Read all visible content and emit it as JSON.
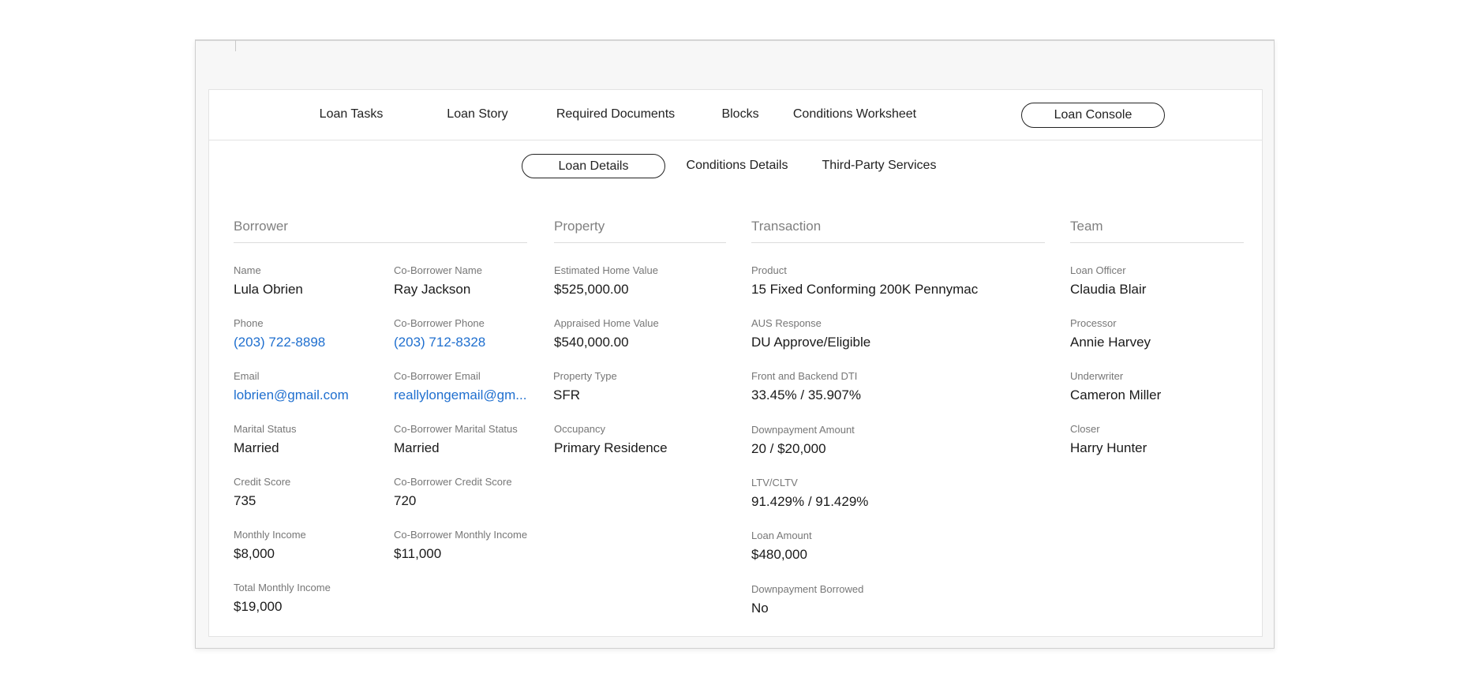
{
  "tabs": [
    {
      "label": "Loan Tasks"
    },
    {
      "label": "Loan Story"
    },
    {
      "label": "Required Documents"
    },
    {
      "label": "Blocks"
    },
    {
      "label": "Conditions Worksheet"
    },
    {
      "label": "Loan Console",
      "active": true
    }
  ],
  "subtabs": [
    {
      "label": "Loan Details",
      "active": true
    },
    {
      "label": "Conditions Details"
    },
    {
      "label": "Third-Party Services"
    }
  ],
  "borrower": {
    "title": "Borrower",
    "name": {
      "label": "Name",
      "value": "Lula Obrien"
    },
    "phone": {
      "label": "Phone",
      "value": "(203) 722-8898"
    },
    "email": {
      "label": "Email",
      "value": "lobrien@gmail.com"
    },
    "marital": {
      "label": "Marital Status",
      "value": "Married"
    },
    "credit": {
      "label": "Credit Score",
      "value": "735"
    },
    "income": {
      "label": "Monthly Income",
      "value": "$8,000"
    },
    "total_income": {
      "label": "Total Monthly Income",
      "value": "$19,000"
    },
    "co_name": {
      "label": "Co-Borrower Name",
      "value": "Ray Jackson"
    },
    "co_phone": {
      "label": "Co-Borrower Phone",
      "value": "(203) 712-8328"
    },
    "co_email": {
      "label": "Co-Borrower Email",
      "value": "reallylongemail@gm..."
    },
    "co_marital": {
      "label": "Co-Borrower Marital Status",
      "value": "Married"
    },
    "co_credit": {
      "label": "Co-Borrower Credit Score",
      "value": "720"
    },
    "co_income": {
      "label": "Co-Borrower Monthly Income",
      "value": "$11,000"
    }
  },
  "property": {
    "title": "Property",
    "est_value": {
      "label": "Estimated Home Value",
      "value": "$525,000.00"
    },
    "appraised": {
      "label": "Appraised Home Value",
      "value": "$540,000.00"
    },
    "type": {
      "label": "Property Type",
      "value": "SFR"
    },
    "occupancy": {
      "label": "Occupancy",
      "value": "Primary Residence"
    }
  },
  "transaction": {
    "title": "Transaction",
    "product": {
      "label": "Product",
      "value": "15 Fixed Conforming 200K Pennymac"
    },
    "aus": {
      "label": "AUS Response",
      "value": "DU Approve/Eligible"
    },
    "dti": {
      "label": "Front and Backend DTI",
      "value": "33.45% / 35.907%"
    },
    "downpayment": {
      "label": "Downpayment Amount",
      "value": "20 / $20,000"
    },
    "ltv": {
      "label": "LTV/CLTV",
      "value": "91.429% / 91.429%"
    },
    "loan_amount": {
      "label": "Loan Amount",
      "value": "$480,000"
    },
    "dp_borrowed": {
      "label": "Downpayment Borrowed",
      "value": "No"
    }
  },
  "team": {
    "title": "Team",
    "loan_officer": {
      "label": "Loan Officer",
      "value": "Claudia Blair"
    },
    "processor": {
      "label": "Processor",
      "value": "Annie Harvey"
    },
    "underwriter": {
      "label": "Underwriter",
      "value": "Cameron Miller"
    },
    "closer": {
      "label": "Closer",
      "value": "Harry Hunter"
    }
  },
  "colors": {
    "link": "#1f6fcf",
    "label": "#777777",
    "section_title": "#808080"
  }
}
